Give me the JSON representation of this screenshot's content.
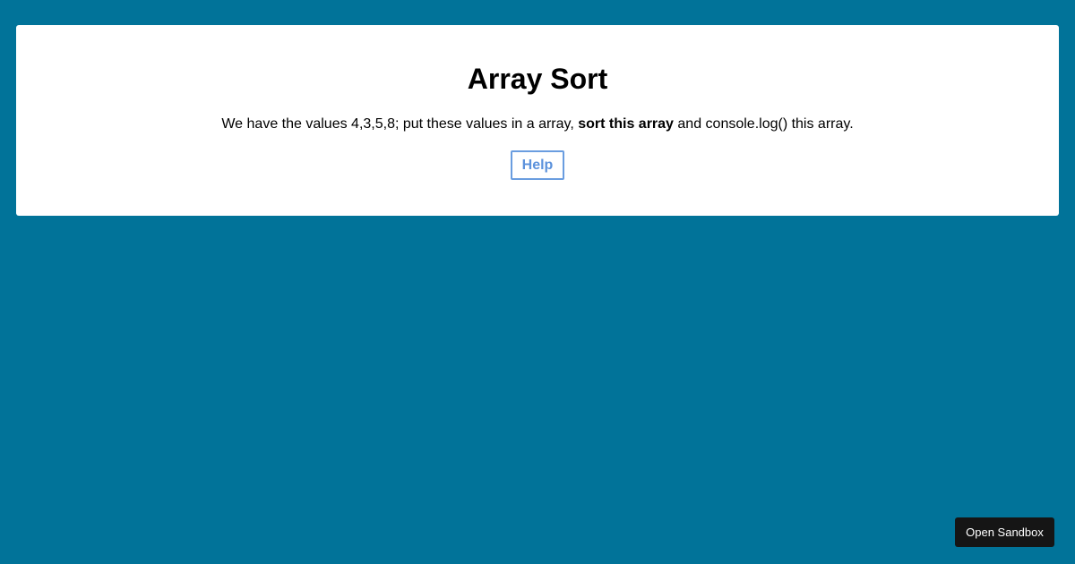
{
  "card": {
    "title": "Array Sort",
    "description": {
      "before": "We have the values 4,3,5,8; put these values in a array, ",
      "bold": "sort this array",
      "after": " and console.log() this array."
    },
    "help_label": "Help"
  },
  "footer": {
    "open_sandbox_label": "Open Sandbox"
  },
  "colors": {
    "page_background": "#017399",
    "card_background": "#ffffff",
    "help_accent": "#5c92dc",
    "sandbox_button_background": "#151515"
  }
}
